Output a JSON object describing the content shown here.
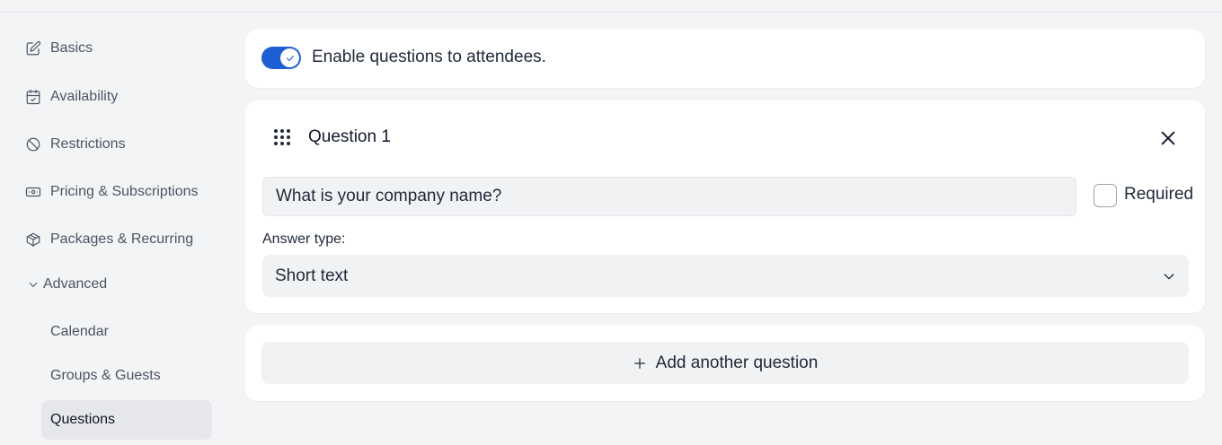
{
  "sidebar": {
    "items": [
      {
        "label": "Basics",
        "icon": "edit-icon"
      },
      {
        "label": "Availability",
        "icon": "calendar-check-icon"
      },
      {
        "label": "Restrictions",
        "icon": "ban-icon"
      },
      {
        "label": "Pricing & Subscriptions",
        "icon": "banknote-icon"
      },
      {
        "label": "Packages & Recurring",
        "icon": "package-icon"
      }
    ],
    "advanced": {
      "label": "Advanced",
      "children": [
        "Calendar",
        "Groups & Guests",
        "Questions"
      ],
      "active": "Questions"
    }
  },
  "settings": {
    "enable_label": "Enable questions to attendees.",
    "enabled": true
  },
  "question": {
    "title": "Question 1",
    "text": "What is your company name?",
    "required_label": "Required",
    "required": false,
    "answer_type_label": "Answer type:",
    "answer_type": "Short text"
  },
  "add_question": {
    "label": "Add another question"
  },
  "colors": {
    "accent": "#1d5fd3",
    "background": "#f3f4f6"
  }
}
